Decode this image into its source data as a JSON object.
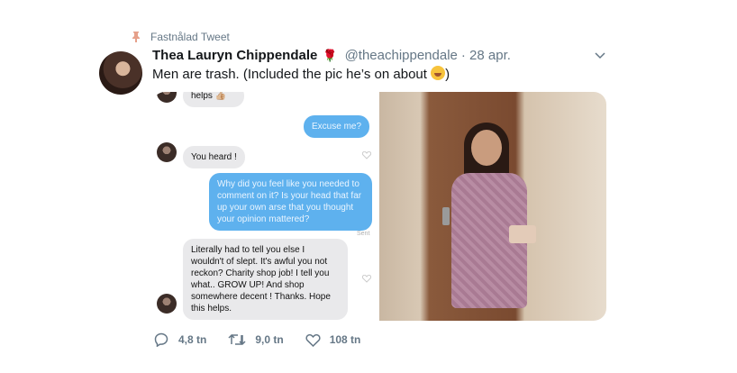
{
  "pinned": {
    "label": "Fastnålad Tweet"
  },
  "author": {
    "name": "Thea Lauryn Chippendale",
    "handle": "@theachippendale",
    "date": "· 28 apr."
  },
  "tweet": {
    "text": "Men are trash. (Included the pic he’s on about ",
    "text_end": ")"
  },
  "chat": {
    "msg_top": "helps 👍🏼",
    "msg_excuse": "Excuse me?",
    "msg_heard": "You heard !",
    "msg_long_blue": "Why did you feel like you needed to comment on it? Is your head that far up your own arse that you thought your opinion mattered?",
    "sent_label": "Sent",
    "msg_long_grey": "Literally had to tell you else I wouldn't of slept. It's awful you not reckon? Charity shop job! I tell you what.. GROW UP! And shop somewhere decent ! Thanks. Hope this helps."
  },
  "actions": {
    "replies": "4,8 tn",
    "retweets": "9,0 tn",
    "likes": "108 tn"
  },
  "colors": {
    "accent": "#1da1f2",
    "muted": "#657786",
    "imessage_blue": "#5eb1ee",
    "rose": "#c0182b"
  },
  "icons": [
    "pin-icon",
    "rose-icon",
    "chevron-down-icon",
    "reply-icon",
    "retweet-icon",
    "like-icon"
  ]
}
